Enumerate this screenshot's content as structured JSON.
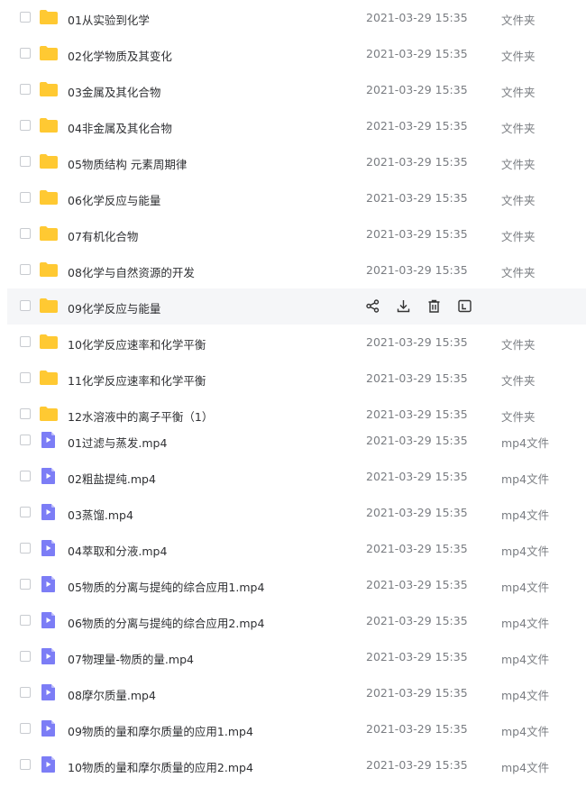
{
  "colors": {
    "folder": "#FFC933",
    "video": "#7C7DF6",
    "hover_row": "#f5f6f8"
  },
  "hover_actions": [
    "share-icon",
    "download-icon",
    "delete-icon",
    "rename-icon"
  ],
  "files": [
    {
      "name": "01从实验到化学",
      "time": "2021-03-29 15:35",
      "type": "文件夹",
      "icon": "folder-icon"
    },
    {
      "name": "02化学物质及其变化",
      "time": "2021-03-29 15:35",
      "type": "文件夹",
      "icon": "folder-icon"
    },
    {
      "name": "03金属及其化合物",
      "time": "2021-03-29 15:35",
      "type": "文件夹",
      "icon": "folder-icon"
    },
    {
      "name": "04非金属及其化合物",
      "time": "2021-03-29 15:35",
      "type": "文件夹",
      "icon": "folder-icon"
    },
    {
      "name": "05物质结构  元素周期律",
      "time": "2021-03-29 15:35",
      "type": "文件夹",
      "icon": "folder-icon"
    },
    {
      "name": "06化学反应与能量",
      "time": "2021-03-29 15:35",
      "type": "文件夹",
      "icon": "folder-icon"
    },
    {
      "name": "07有机化合物",
      "time": "2021-03-29 15:35",
      "type": "文件夹",
      "icon": "folder-icon"
    },
    {
      "name": "08化学与自然资源的开发",
      "time": "2021-03-29 15:35",
      "type": "文件夹",
      "icon": "folder-icon"
    },
    {
      "name": "09化学反应与能量",
      "time": "",
      "type": "",
      "icon": "folder-icon",
      "hover": true
    },
    {
      "name": "10化学反应速率和化学平衡",
      "time": "2021-03-29 15:35",
      "type": "文件夹",
      "icon": "folder-icon"
    },
    {
      "name": "11化学反应速率和化学平衡",
      "time": "2021-03-29 15:35",
      "type": "文件夹",
      "icon": "folder-icon"
    },
    {
      "name": "12水溶液中的离子平衡（1）",
      "time": "2021-03-29 15:35",
      "type": "文件夹",
      "icon": "folder-icon"
    },
    {
      "name": "01过滤与蒸发.mp4",
      "time": "2021-03-29 15:35",
      "type": "mp4文件",
      "icon": "video-file-icon"
    },
    {
      "name": "02粗盐提纯.mp4",
      "time": "2021-03-29 15:35",
      "type": "mp4文件",
      "icon": "video-file-icon"
    },
    {
      "name": "03蒸馏.mp4",
      "time": "2021-03-29 15:35",
      "type": "mp4文件",
      "icon": "video-file-icon"
    },
    {
      "name": "04萃取和分液.mp4",
      "time": "2021-03-29 15:35",
      "type": "mp4文件",
      "icon": "video-file-icon"
    },
    {
      "name": "05物质的分离与提纯的综合应用1.mp4",
      "time": "2021-03-29 15:35",
      "type": "mp4文件",
      "icon": "video-file-icon"
    },
    {
      "name": "06物质的分离与提纯的综合应用2.mp4",
      "time": "2021-03-29 15:35",
      "type": "mp4文件",
      "icon": "video-file-icon"
    },
    {
      "name": "07物理量-物质的量.mp4",
      "time": "2021-03-29 15:35",
      "type": "mp4文件",
      "icon": "video-file-icon"
    },
    {
      "name": "08摩尔质量.mp4",
      "time": "2021-03-29 15:35",
      "type": "mp4文件",
      "icon": "video-file-icon"
    },
    {
      "name": "09物质的量和摩尔质量的应用1.mp4",
      "time": "2021-03-29 15:35",
      "type": "mp4文件",
      "icon": "video-file-icon"
    },
    {
      "name": "10物质的量和摩尔质量的应用2.mp4",
      "time": "2021-03-29 15:35",
      "type": "mp4文件",
      "icon": "video-file-icon"
    }
  ]
}
